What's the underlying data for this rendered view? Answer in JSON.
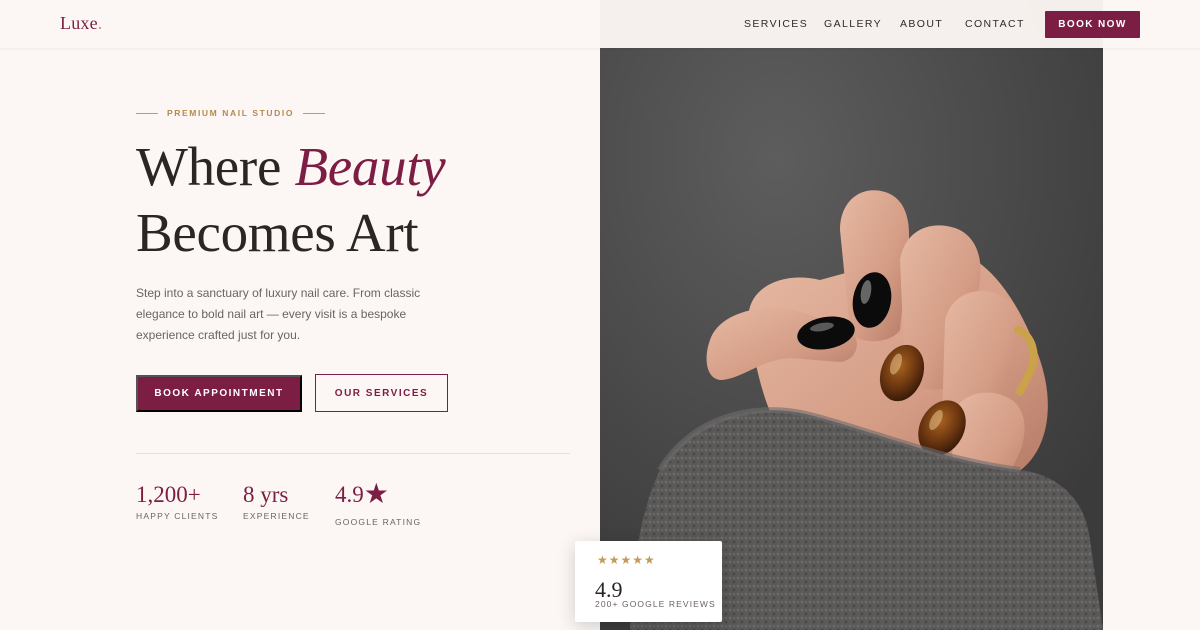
{
  "brand": {
    "name": "Luxe",
    "dot": "."
  },
  "nav": {
    "items": [
      "SERVICES",
      "GALLERY",
      "ABOUT",
      "CONTACT"
    ],
    "cta": "BOOK NOW"
  },
  "hero": {
    "eyebrow": "PREMIUM NAIL STUDIO",
    "headline_part1": "Where ",
    "headline_accent": "Beauty",
    "headline_line2": "Becomes Art",
    "lede": "Step into a sanctuary of luxury nail care. From classic elegance to bold nail art — every visit is a bespoke experience crafted just for you.",
    "primary_button": "BOOK APPOINTMENT",
    "secondary_button": "OUR SERVICES"
  },
  "stats": [
    {
      "value": "1,200+",
      "label": "HAPPY CLIENTS"
    },
    {
      "value": "8 yrs",
      "label": "EXPERIENCE"
    },
    {
      "value": "4.9",
      "star": "★",
      "label": "GOOGLE RATING"
    }
  ],
  "review_card": {
    "stars": "★★★★★",
    "score": "4.9",
    "caption": "200+ GOOGLE REVIEWS"
  },
  "colors": {
    "background": "#fcf7f4",
    "accent": "#7c1d43",
    "gold": "#c29b5c",
    "text": "#2d2a28"
  },
  "icons": {
    "rating": "star-icon"
  }
}
